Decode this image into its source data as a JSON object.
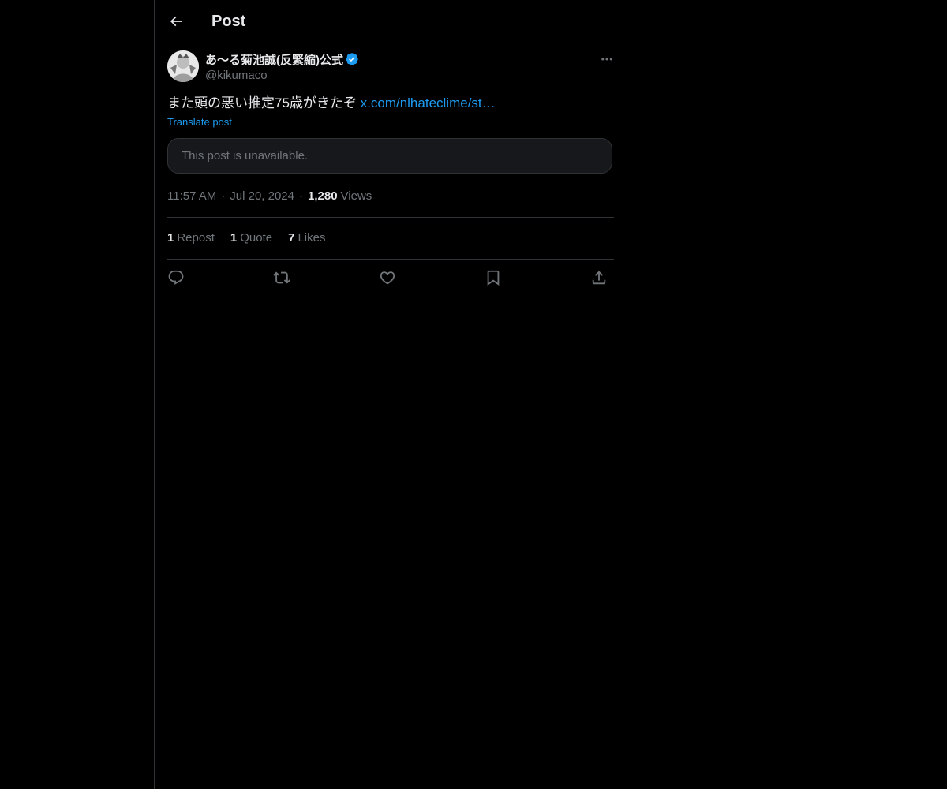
{
  "header": {
    "title": "Post",
    "back_icon": "arrow-left-icon"
  },
  "author": {
    "display_name": "あ〜る菊池誠(反緊縮)公式",
    "handle": "@kikumaco",
    "verified": true,
    "verified_color": "#1d9bf0"
  },
  "tweet": {
    "text": "また頭の悪い推定75歳がきたぞ ",
    "link_text": "x.com/nlhateclime/st…",
    "translate_label": "Translate post",
    "quoted_unavailable": "This post is unavailable."
  },
  "meta": {
    "time": "11:57 AM",
    "separator": "·",
    "date": "Jul 20, 2024",
    "views_count": "1,280",
    "views_label": "Views"
  },
  "stats": {
    "reposts_count": "1",
    "reposts_label": "Repost",
    "quotes_count": "1",
    "quotes_label": "Quote",
    "likes_count": "7",
    "likes_label": "Likes"
  },
  "actions": [
    "reply-icon",
    "retweet-icon",
    "like-icon",
    "bookmark-icon",
    "share-icon"
  ],
  "colors": {
    "background": "#000000",
    "text": "#e7e9ea",
    "secondary": "#71767b",
    "accent": "#1d9bf0",
    "border": "#2f3336"
  }
}
